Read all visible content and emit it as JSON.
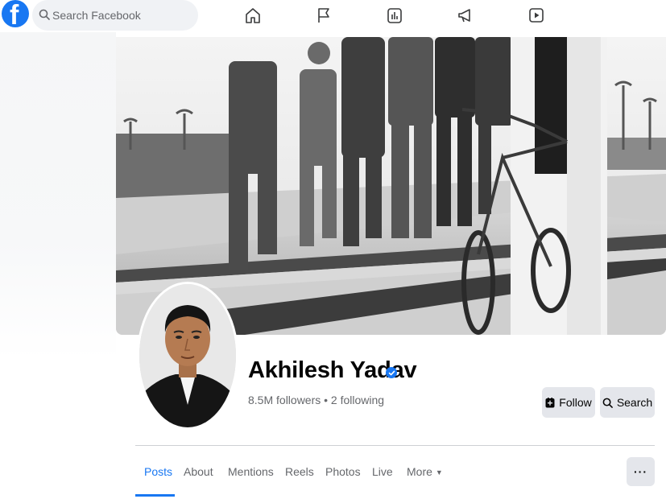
{
  "topbar": {
    "logo_letter": "f",
    "search_placeholder": "Search Facebook",
    "nav_icons": [
      "home-icon",
      "flag-icon",
      "chart-icon",
      "megaphone-icon",
      "video-icon"
    ]
  },
  "profile": {
    "name": "Akhilesh Yadav",
    "verified": true,
    "followers_text": "8.5M followers • 2 following"
  },
  "actions": {
    "follow_label": "Follow",
    "search_label": "Search"
  },
  "tabs": [
    {
      "label": "Posts",
      "active": true
    },
    {
      "label": "About",
      "active": false
    },
    {
      "label": "Mentions",
      "active": false
    },
    {
      "label": "Reels",
      "active": false
    },
    {
      "label": "Photos",
      "active": false
    },
    {
      "label": "Live",
      "active": false
    },
    {
      "label": "More",
      "active": false
    }
  ],
  "more_caret": "▼",
  "menu_label": "···",
  "colors": {
    "brand": "#1877f2",
    "button_bg": "#e4e6eb",
    "muted_text": "#65676b"
  }
}
